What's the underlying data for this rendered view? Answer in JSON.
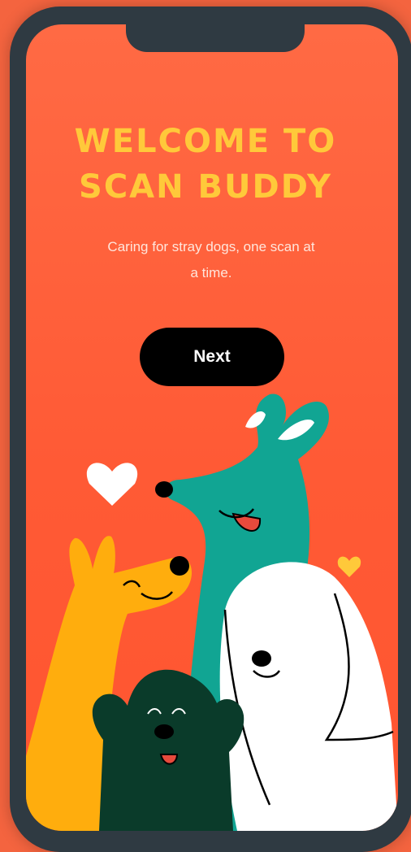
{
  "welcome": {
    "title_line1": "WELCOME TO",
    "title_line2": "SCAN BUDDY",
    "subtitle": "Caring for stray dogs, one scan at a time.",
    "next_label": "Next"
  },
  "colors": {
    "background": "#ff5a35",
    "title": "#ffc93a",
    "button": "#000000",
    "button_text": "#ffffff",
    "frame": "#2f3a42"
  },
  "icons": [
    "heart-icon"
  ]
}
